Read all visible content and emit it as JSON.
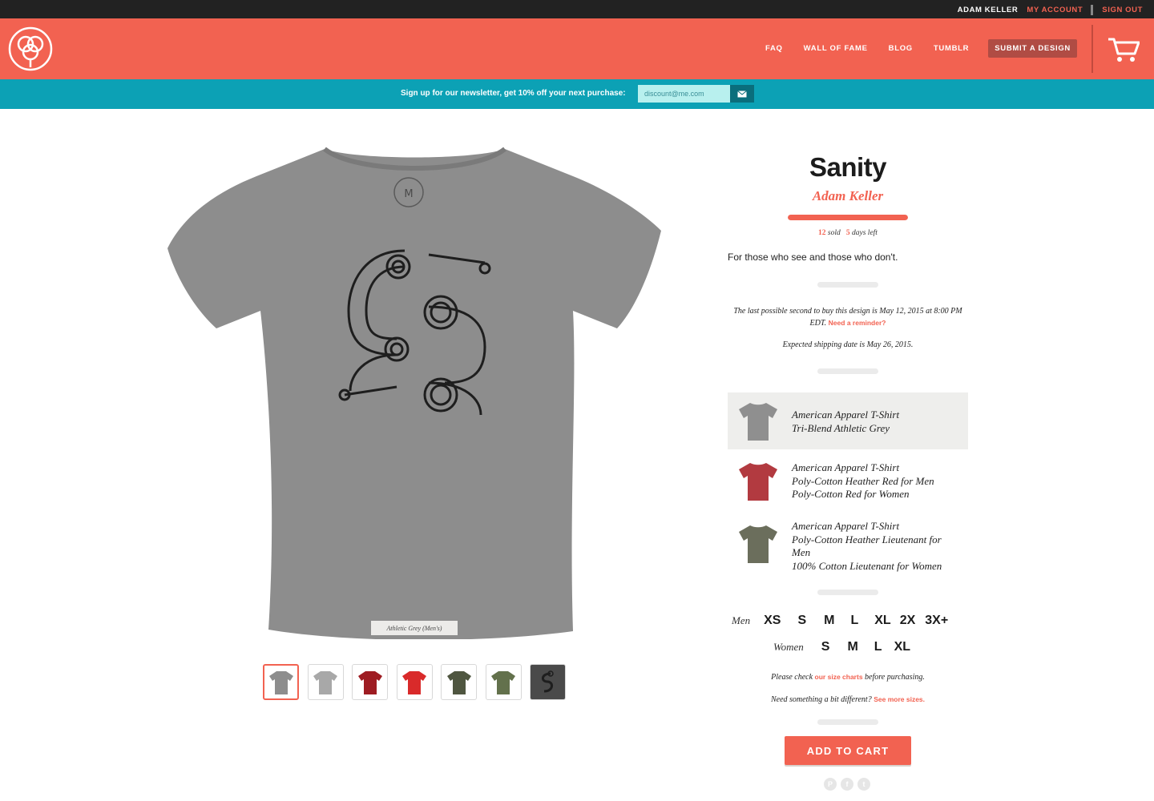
{
  "topbar": {
    "user": "ADAM KELLER",
    "my_account": "MY ACCOUNT",
    "sign_out": "SIGN OUT"
  },
  "nav": {
    "faq": "FAQ",
    "wall_of_fame": "WALL OF FAME",
    "blog": "BLOG",
    "tumblr": "TUMBLR",
    "submit": "SUBMIT A DESIGN"
  },
  "newsletter": {
    "label": "Sign up for our newsletter, get 10% off your next purchase:",
    "email_value": "discount@me.com"
  },
  "product": {
    "title": "Sanity",
    "artist": "Adam Keller",
    "progress": 1.0,
    "sold_count": "12",
    "sold_label": "sold",
    "days_count": "5",
    "days_label": "days left",
    "tagline": "For those who see and those who don't.",
    "image_caption": "Athletic Grey (Men's)"
  },
  "deadline": {
    "text": "The last possible second to buy this design is May 12, 2015 at 8:00 PM EDT.",
    "reminder_link": "Need a reminder?",
    "shipping": "Expected shipping date is May 26, 2015."
  },
  "styles": [
    {
      "line1": "American Apparel T-Shirt",
      "line2": "Tri-Blend Athletic Grey",
      "line3": "",
      "line4": "",
      "color": "#8f8f8f",
      "selected": true
    },
    {
      "line1": "American Apparel T-Shirt",
      "line2": "Poly-Cotton Heather Red for Men",
      "line3": "Poly-Cotton Red for Women",
      "line4": "",
      "color": "#b23a40",
      "selected": false
    },
    {
      "line1": "American Apparel T-Shirt",
      "line2": "Poly-Cotton Heather Lieutenant for",
      "line3": "Men",
      "line4": "100% Cotton Lieutenant for Women",
      "color": "#6b6e5c",
      "selected": false
    }
  ],
  "sizes": {
    "men_label": "Men",
    "men": [
      "XS",
      "S",
      "M",
      "L",
      "XL",
      "2X",
      "3X+"
    ],
    "women_label": "Women",
    "women": [
      "S",
      "M",
      "L",
      "XL"
    ]
  },
  "notes": {
    "size_prefix": "Please check",
    "size_link": "our size charts",
    "size_suffix": "before purchasing.",
    "diff_prefix": "Need something a bit different?",
    "diff_link": "See more sizes."
  },
  "add_to_cart": "ADD TO CART",
  "social": [
    "pinterest-icon",
    "facebook-icon",
    "twitter-icon"
  ],
  "colors": {
    "brand": "#f26251",
    "teal": "#0ca1b5",
    "dark": "#222222"
  }
}
